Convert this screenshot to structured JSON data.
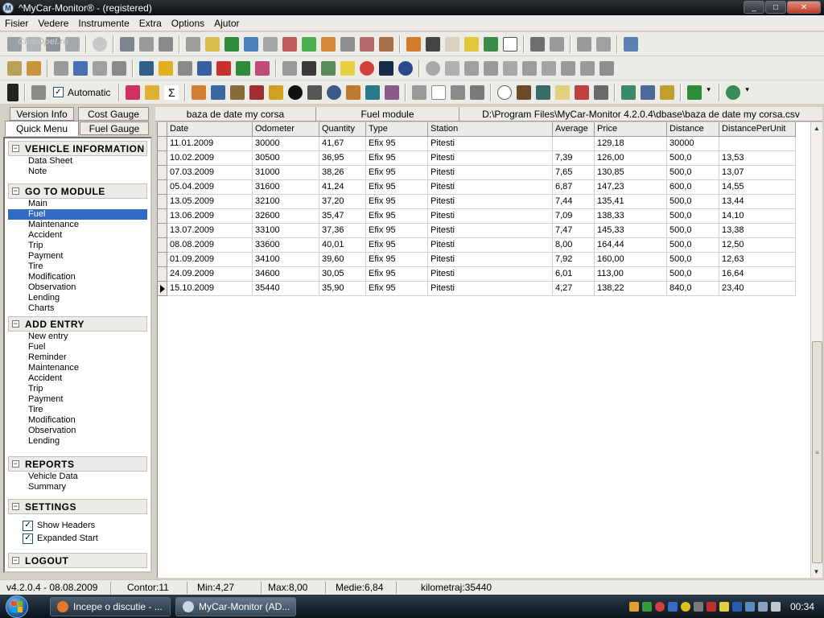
{
  "window": {
    "title": "^MyCar-Monitor® - (registered)",
    "app_icon_letter": "M",
    "min": "_",
    "max": "□",
    "close": "✕"
  },
  "menu": [
    "Fisier",
    "Vedere",
    "Instrumente",
    "Extra",
    "Options",
    "Ajutor"
  ],
  "watermark": "ClubOpel.ro",
  "toolbar3": {
    "automatic_label": "Automatic",
    "automatic_checked": true
  },
  "left_tabs": {
    "version_info": "Version Info",
    "cost_gauge": "Cost Gauge",
    "quick_menu": "Quick Menu",
    "fuel_gauge": "Fuel Gauge"
  },
  "sections": {
    "vehicle_information": {
      "title": "VEHICLE INFORMATION",
      "items": [
        "Data Sheet",
        "Note"
      ]
    },
    "go_to_module": {
      "title": "GO TO MODULE",
      "items": [
        "Main",
        "Fuel",
        "Maintenance",
        "Accident",
        "Trip",
        "Payment",
        "Tire",
        "Modification",
        "Observation",
        "Lending",
        "Charts"
      ]
    },
    "add_entry": {
      "title": "ADD ENTRY",
      "items": [
        "New entry",
        "Fuel",
        "Reminder",
        "Maintenance",
        "Accident",
        "Trip",
        "Payment",
        "Tire",
        "Modification",
        "Observation",
        "Lending"
      ]
    },
    "reports": {
      "title": "REPORTS",
      "items": [
        "Vehicle Data",
        "Summary"
      ]
    },
    "settings": {
      "title": "SETTINGS",
      "show_headers": "Show Headers",
      "expanded_start": "Expanded Start"
    },
    "logout": {
      "title": "LOGOUT"
    }
  },
  "expander_symbol": "⊟",
  "right_header": {
    "database": "baza de date my corsa",
    "module": "Fuel module",
    "path": "D:\\Program Files\\MyCar-Monitor 4.2.0.4\\dbase\\baza de date my corsa.csv"
  },
  "grid": {
    "columns": [
      "Date",
      "Odometer",
      "Quantity",
      "Type",
      "Station",
      "Average",
      "Price",
      "Distance",
      "DistancePerUnit"
    ],
    "rows": [
      [
        "11.01.2009",
        "30000",
        "41,67",
        "Efix 95",
        "Pitesti",
        "",
        "129,18",
        "30000",
        ""
      ],
      [
        "10.02.2009",
        "30500",
        "36,95",
        "Efix 95",
        "Pitesti",
        "7,39",
        "126,00",
        "500,0",
        "13,53"
      ],
      [
        "07.03.2009",
        "31000",
        "38,26",
        "Efix 95",
        "Pitesti",
        "7,65",
        "130,85",
        "500,0",
        "13,07"
      ],
      [
        "05.04.2009",
        "31600",
        "41,24",
        "Efix 95",
        "Pitesti",
        "6,87",
        "147,23",
        "600,0",
        "14,55"
      ],
      [
        "13.05.2009",
        "32100",
        "37,20",
        "Efix 95",
        "Pitesti",
        "7,44",
        "135,41",
        "500,0",
        "13,44"
      ],
      [
        "13.06.2009",
        "32600",
        "35,47",
        "Efix 95",
        "Pitesti",
        "7,09",
        "138,33",
        "500,0",
        "14,10"
      ],
      [
        "13.07.2009",
        "33100",
        "37,36",
        "Efix 95",
        "Pitesti",
        "7,47",
        "145,33",
        "500,0",
        "13,38"
      ],
      [
        "08.08.2009",
        "33600",
        "40,01",
        "Efix 95",
        "Pitesti",
        "8,00",
        "164,44",
        "500,0",
        "12,50"
      ],
      [
        "01.09.2009",
        "34100",
        "39,60",
        "Efix 95",
        "Pitesti",
        "7,92",
        "160,00",
        "500,0",
        "12,63"
      ],
      [
        "24.09.2009",
        "34600",
        "30,05",
        "Efix 95",
        "Pitesti",
        "6,01",
        "113,00",
        "500,0",
        "16,64"
      ],
      [
        "15.10.2009",
        "35440",
        "35,90",
        "Efix 95",
        "Pitesti",
        "4,27",
        "138,22",
        "840,0",
        "23,40"
      ]
    ],
    "current_row": 10
  },
  "status": {
    "version": "v4.2.0.4 - 08.08.2009",
    "contor": "Contor:11",
    "min": "Min:4,27",
    "max": "Max:8,00",
    "medie": "Medie:6,84",
    "km": "kilometraj:35440"
  },
  "taskbar": {
    "task1": "Incepe o discutie - ...",
    "task2": "MyCar-Monitor (AD...",
    "clock": "00:34"
  }
}
